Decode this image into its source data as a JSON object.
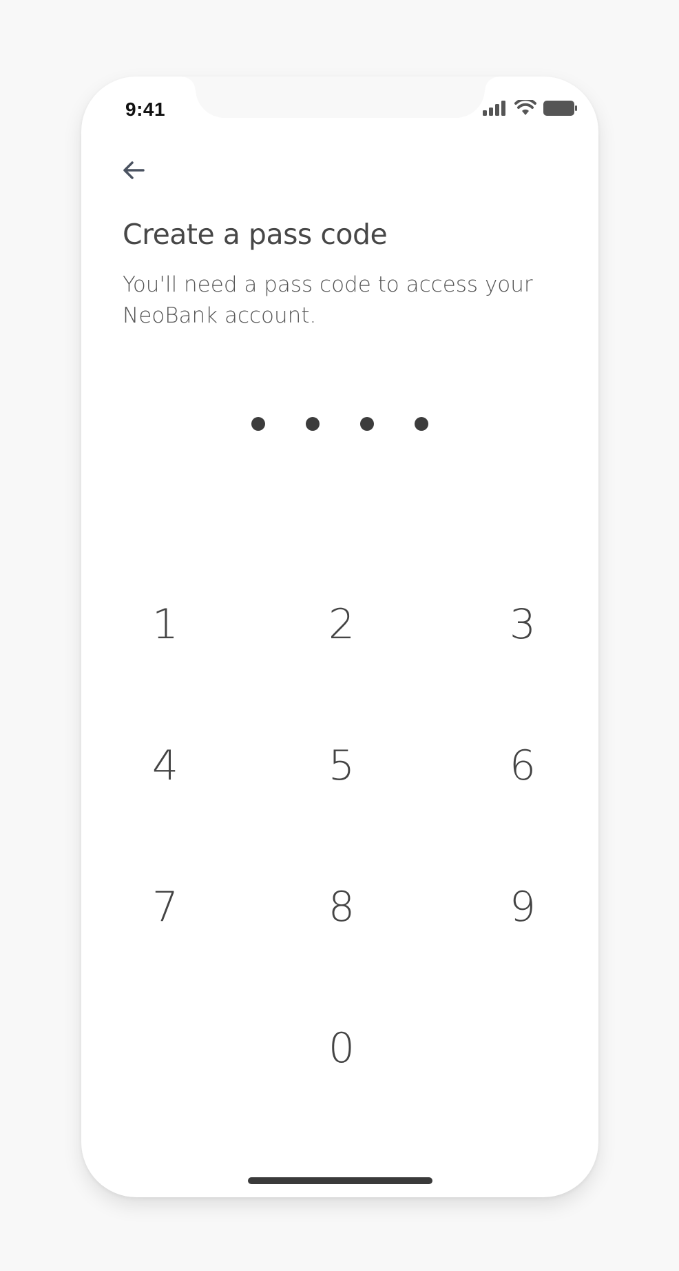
{
  "status_bar": {
    "time": "9:41",
    "icons": [
      "signal-icon",
      "wifi-icon",
      "battery-icon"
    ]
  },
  "header": {
    "back_icon": "arrow-left-icon"
  },
  "main": {
    "title": "Create a pass code",
    "subtitle": "You'll need a pass code to access your NeoBank account."
  },
  "pin": {
    "entered": 4,
    "total": 4
  },
  "keypad": {
    "keys": [
      "1",
      "2",
      "3",
      "4",
      "5",
      "6",
      "7",
      "8",
      "9",
      "0"
    ]
  },
  "colors": {
    "text": "#474747",
    "dot": "#3c3c3c",
    "background": "#ffffff"
  }
}
